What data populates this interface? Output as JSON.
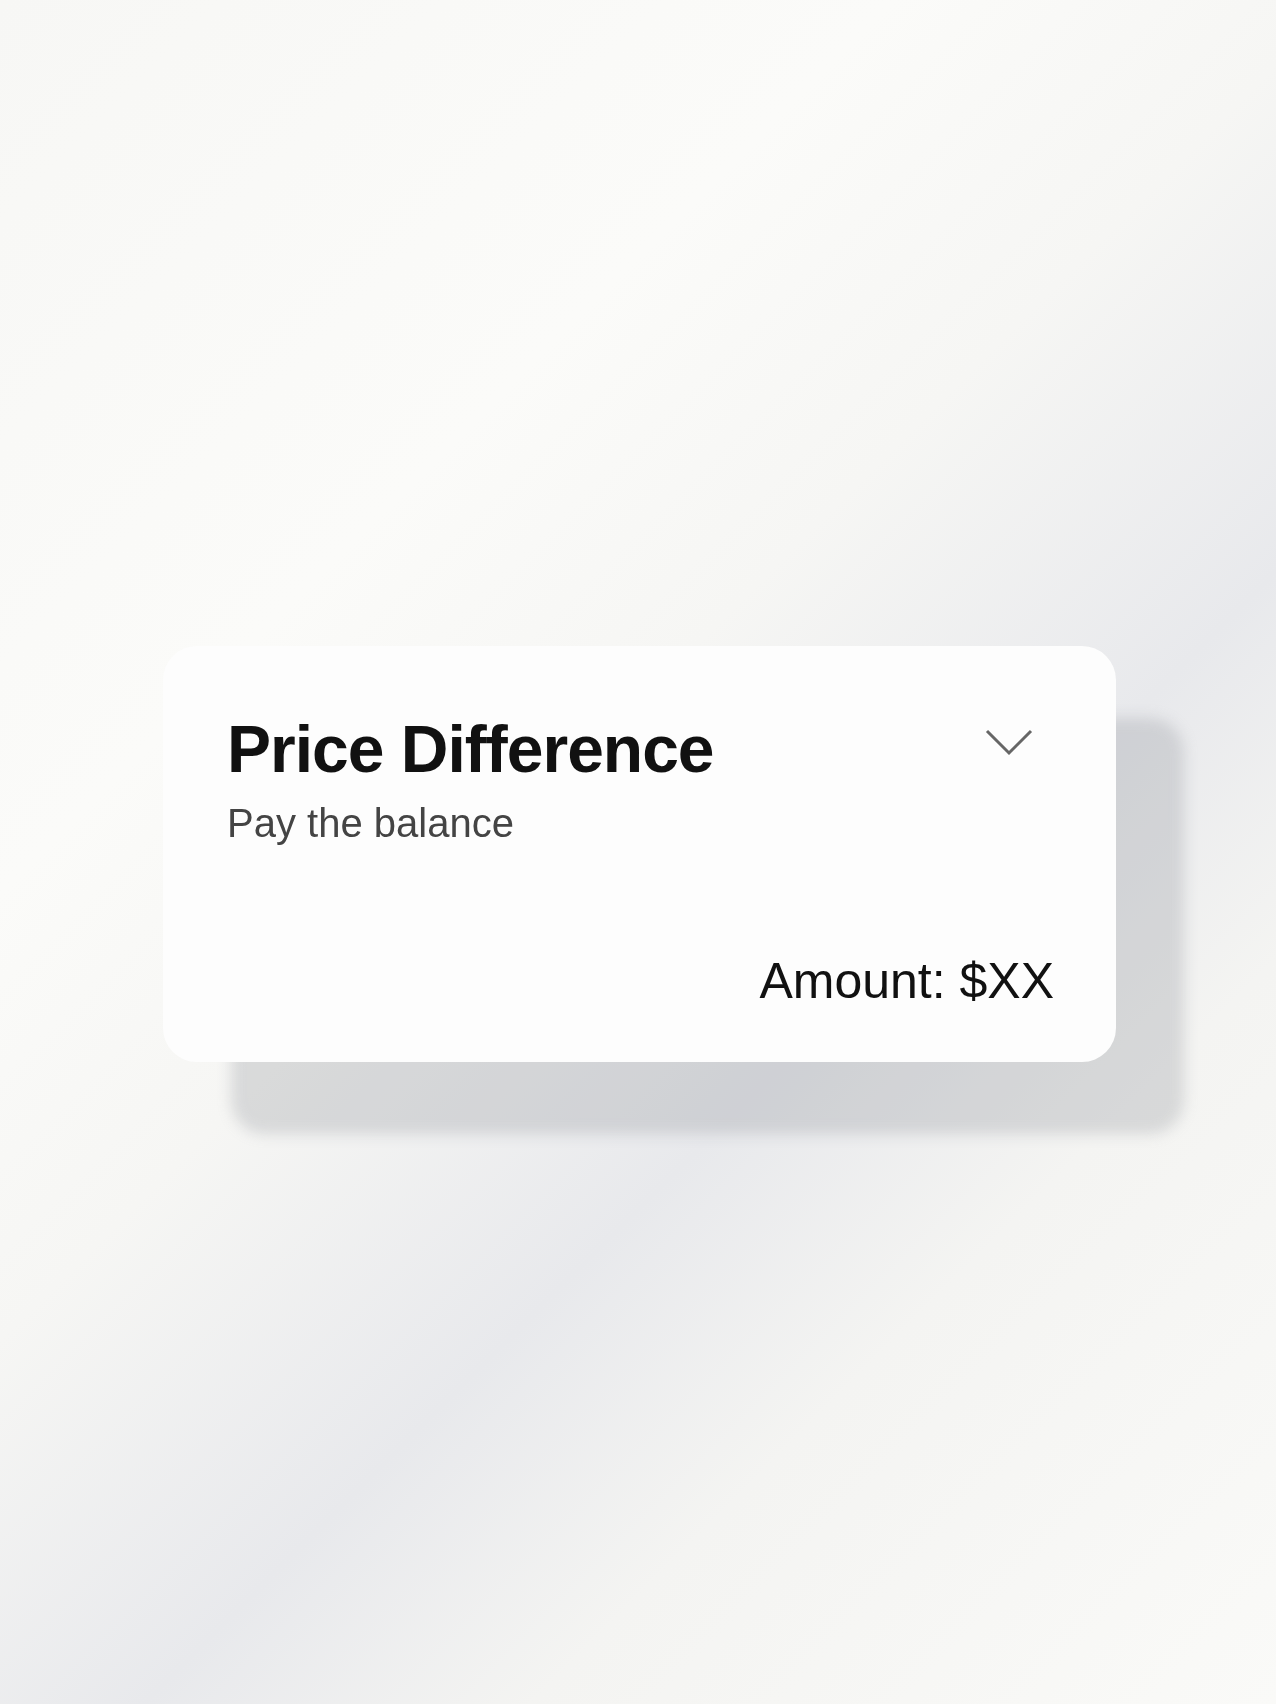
{
  "card": {
    "title": "Price Difference",
    "subtitle": "Pay the balance",
    "amount": "Amount: $XX",
    "expanded": false
  }
}
